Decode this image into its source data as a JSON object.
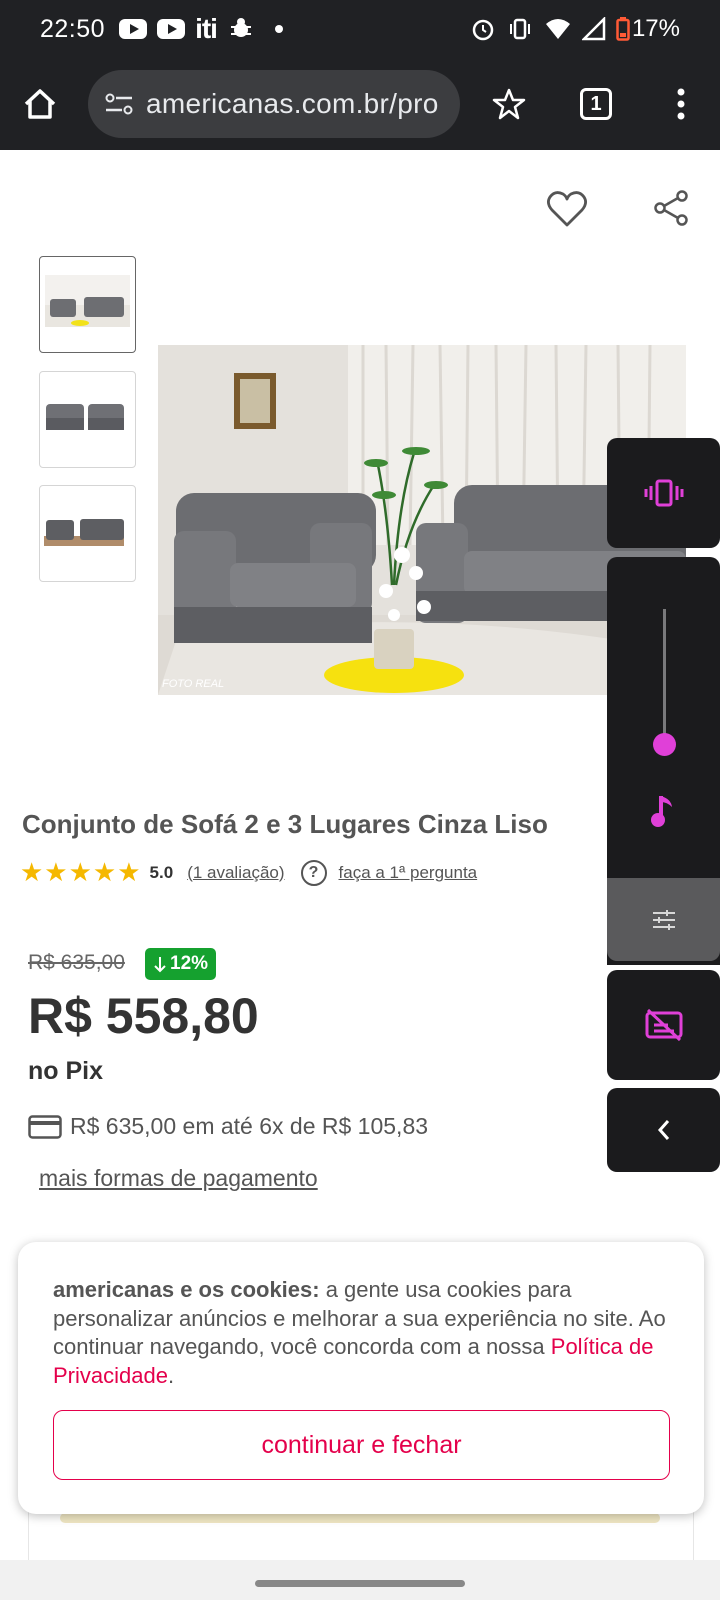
{
  "status_bar": {
    "time": "22:50",
    "carrier_icon": "iti",
    "battery": "17%",
    "left_icons": [
      "youtube-icon",
      "youtube-icon",
      "iti-icon",
      "bug-icon",
      "dot-icon"
    ],
    "right_icons": [
      "alarm-icon",
      "vibrate-icon",
      "wifi-icon",
      "signal-icon",
      "battery-icon"
    ]
  },
  "browser": {
    "url": "americanas.com.br/pro",
    "tab_count": "1"
  },
  "product": {
    "title": "Conjunto de Sofá 2 e 3 Lugares Cinza Liso",
    "score": "5.0",
    "reviews_label": "(1 avaliação)",
    "ask_label": "faça a 1ª pergunta",
    "old_price": "R$ 635,00",
    "discount": "12%",
    "price": "R$ 558,80",
    "price_method": "no Pix",
    "installment": "R$ 635,00 em até 6x de R$ 105,83",
    "more_payment": "mais formas de pagamento",
    "photo_watermark": "FOTO REAL"
  },
  "volume_panel": {
    "level": 0.15,
    "accent": "#e040d8"
  },
  "cookie": {
    "bold": "americanas e os cookies:",
    "text": " a gente usa cookies para personalizar anúncios e melhorar a sua experiência no site. Ao continuar navegando, você concorda com a nossa ",
    "link": "Política de Privacidade",
    "end": ".",
    "button": "continuar e fechar"
  },
  "colors": {
    "brand": "#e4004b",
    "discount_bg": "#15a12f",
    "star": "#f5b800",
    "browser_bg": "#202124"
  }
}
